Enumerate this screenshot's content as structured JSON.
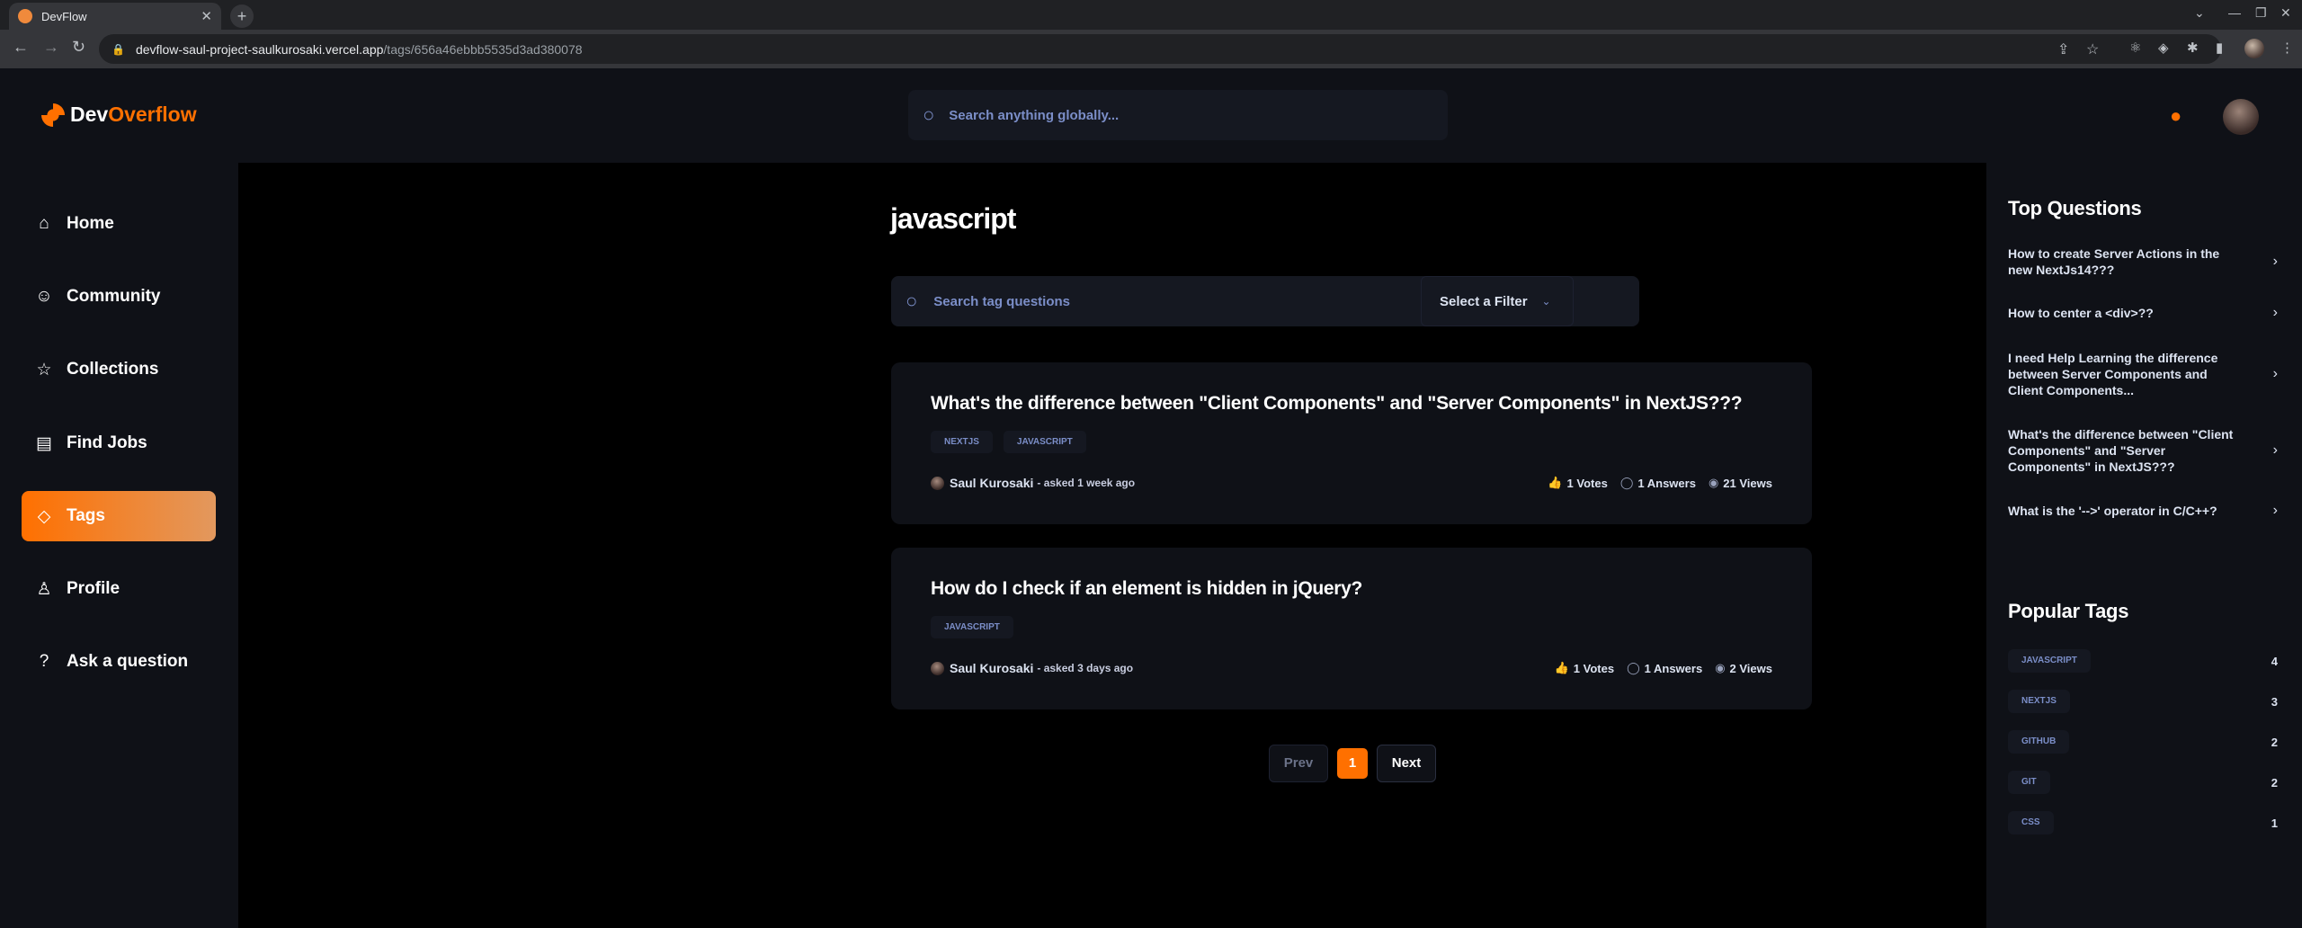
{
  "browser": {
    "tab_title": "DevFlow",
    "url_host": "devflow-saul-project-saulkurosaki.vercel.app",
    "url_path": "/tags/656a46ebbb5535d3ad380078"
  },
  "header": {
    "logo_a": "Dev",
    "logo_b": "Overflow",
    "search_placeholder": "Search anything globally..."
  },
  "sidebar": {
    "items": [
      {
        "label": "Home",
        "icon": "home-icon"
      },
      {
        "label": "Community",
        "icon": "users-icon"
      },
      {
        "label": "Collections",
        "icon": "star-icon"
      },
      {
        "label": "Find Jobs",
        "icon": "briefcase-icon"
      },
      {
        "label": "Tags",
        "icon": "tag-icon",
        "active": true
      },
      {
        "label": "Profile",
        "icon": "user-icon"
      },
      {
        "label": "Ask a question",
        "icon": "question-icon"
      }
    ]
  },
  "main": {
    "title": "javascript",
    "search_placeholder": "Search tag questions",
    "filter_label": "Select a Filter",
    "questions": [
      {
        "title": "What's the difference between \"Client Components\" and \"Server Components\" in NextJS???",
        "tags": [
          "NEXTJS",
          "JAVASCRIPT"
        ],
        "author": "Saul Kurosaki",
        "time": "- asked 1 week ago",
        "votes": "1 Votes",
        "answers": "1 Answers",
        "views": "21 Views"
      },
      {
        "title": "How do I check if an element is hidden in jQuery?",
        "tags": [
          "JAVASCRIPT"
        ],
        "author": "Saul Kurosaki",
        "time": "- asked 3 days ago",
        "votes": "1 Votes",
        "answers": "1 Answers",
        "views": "2 Views"
      }
    ],
    "pagination": {
      "prev": "Prev",
      "page": "1",
      "next": "Next"
    }
  },
  "right": {
    "top_heading": "Top Questions",
    "top_questions": [
      "How to create Server Actions in the new NextJs14???",
      "How to center a <div>??",
      "I need Help Learning the difference between Server Components and Client Components...",
      "What's the difference between \"Client Components\" and \"Server Components\" in NextJS???",
      "What is the '-->' operator in C/C++?"
    ],
    "tags_heading": "Popular Tags",
    "popular_tags": [
      {
        "name": "JAVASCRIPT",
        "count": "4"
      },
      {
        "name": "NEXTJS",
        "count": "3"
      },
      {
        "name": "GITHUB",
        "count": "2"
      },
      {
        "name": "GIT",
        "count": "2"
      },
      {
        "name": "CSS",
        "count": "1"
      }
    ]
  },
  "colors": {
    "accent": "#ff7000",
    "bg": "#000000",
    "panel": "#0f1117",
    "muted": "#7b8ec8"
  }
}
